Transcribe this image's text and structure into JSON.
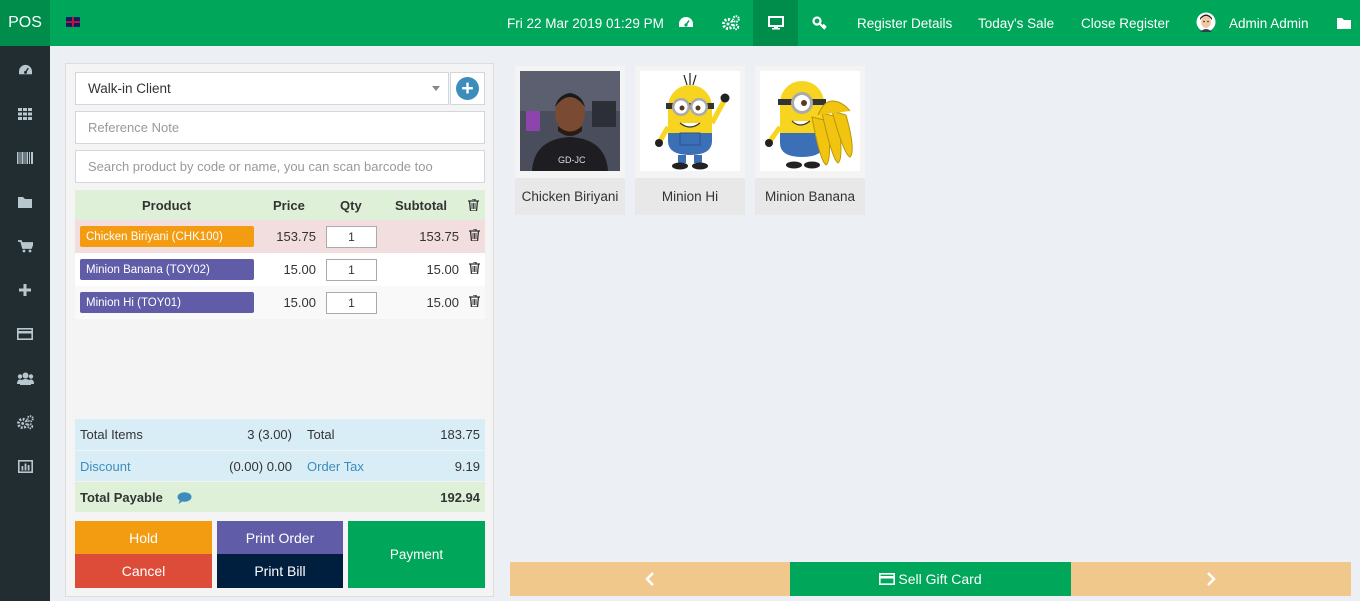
{
  "app": {
    "brand": "POS",
    "language_flag": "uk-flag-icon"
  },
  "topbar": {
    "datetime": "Fri 22 Mar 2019 01:29 PM",
    "register_details": "Register Details",
    "todays_sale": "Today's Sale",
    "close_register": "Close Register",
    "user_name": "Admin Admin"
  },
  "sidebar": {
    "items": [
      "dashboard-icon",
      "products-grid-icon",
      "barcode-icon",
      "folder-icon",
      "cart-icon",
      "plus-icon",
      "credit-card-icon",
      "users-icon",
      "settings-icon",
      "reports-chart-icon"
    ]
  },
  "customer": {
    "selected": "Walk-in Client"
  },
  "reference": {
    "placeholder": "Reference Note"
  },
  "search": {
    "placeholder": "Search product by code or name, you can scan barcode too"
  },
  "table": {
    "headers": {
      "product": "Product",
      "price": "Price",
      "qty": "Qty",
      "subtotal": "Subtotal"
    },
    "rows": [
      {
        "product": "Chicken Biriyani (CHK100)",
        "price": "153.75",
        "qty": "1",
        "subtotal": "153.75",
        "color": "#f39c12"
      },
      {
        "product": "Minion Banana (TOY02)",
        "price": "15.00",
        "qty": "1",
        "subtotal": "15.00",
        "color": "#605ca8"
      },
      {
        "product": "Minion Hi (TOY01)",
        "price": "15.00",
        "qty": "1",
        "subtotal": "15.00",
        "color": "#605ca8"
      }
    ]
  },
  "totals": {
    "items_label": "Total Items",
    "items_value": "3 (3.00)",
    "total_label": "Total",
    "total_value": "183.75",
    "discount_label": "Discount",
    "discount_value": "(0.00) 0.00",
    "tax_label": "Order Tax",
    "tax_value": "9.19",
    "payable_label": "Total Payable",
    "payable_value": "192.94"
  },
  "actions": {
    "hold": "Hold",
    "print_order": "Print Order",
    "payment": "Payment",
    "cancel": "Cancel",
    "print_bill": "Print Bill"
  },
  "products": [
    {
      "name": "Chicken Biriyani"
    },
    {
      "name": "Minion Hi"
    },
    {
      "name": "Minion Banana"
    }
  ],
  "bottom": {
    "gift_card": "Sell Gift Card"
  },
  "colors": {
    "primary": "#00a65a",
    "primary_dark": "#008d4c",
    "sidebar": "#222d32",
    "orange": "#f39c12",
    "purple": "#605ca8",
    "red": "#dd4b39",
    "navy": "#001f3f",
    "pager": "#f0c88c"
  }
}
